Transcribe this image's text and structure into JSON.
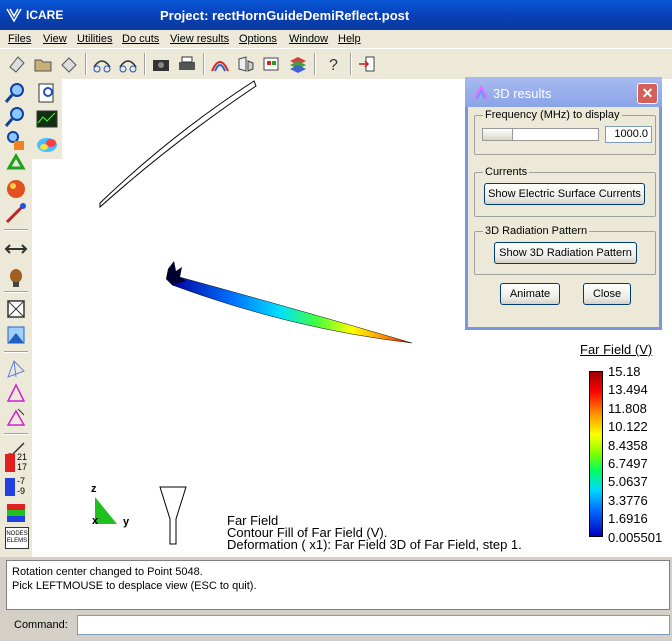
{
  "window": {
    "app_title": "ICARE",
    "project_title": "Project: rectHornGuideDemiReflect.post"
  },
  "menu": [
    "Files",
    "View",
    "Utilities",
    "Do cuts",
    "View results",
    "Options",
    "Window",
    "Help"
  ],
  "toolbar_icons": [
    "new-file-icon",
    "open-folder-icon",
    "save-icon",
    "view-rotate-left-icon",
    "view-rotate-right-icon",
    "camera-icon",
    "printer-icon",
    "rainbow-icon",
    "flip-icon",
    "color-palette-icon",
    "layers-icon",
    "help-icon",
    "exit-icon"
  ],
  "left_toolbar": {
    "labels_small": {
      "v1": "21",
      "v2": "17",
      "v3": "-7",
      "v4": "-9",
      "nodes": "NODES",
      "elems": "ELEMS"
    }
  },
  "dialog": {
    "title": "3D results",
    "freq_group": "Frequency (MHz) to display",
    "freq_value": "1000.0",
    "freq_slider_fraction": 0.0,
    "currents_group": "Currents",
    "currents_button": "Show Electric Surface Currents",
    "radiation_group": "3D Radiation Pattern",
    "radiation_button": "Show 3D Radiation Pattern",
    "animate_button": "Animate",
    "close_button": "Close"
  },
  "legend": {
    "title": "Far Field (V)",
    "values": [
      "15.18",
      "13.494",
      "11.808",
      "10.122",
      "8.4358",
      "6.7497",
      "5.0637",
      "3.3776",
      "1.6916",
      "0.005501"
    ]
  },
  "viewport_text": {
    "line1": "Far Field",
    "line2": "Contour Fill of Far Field (V).",
    "line3": "Deformation ( x1): Far Field 3D of Far Field, step 1."
  },
  "axes": {
    "z": "z",
    "x": "x",
    "y": "y"
  },
  "messages": [
    "Rotation center changed to Point 5048.",
    "Pick LEFTMOUSE to desplace view (ESC to quit)."
  ],
  "command": {
    "label": "Command:",
    "value": ""
  },
  "colors": {
    "title_bar": "#0a58d8",
    "dialog_title": "#8aa4e8"
  }
}
